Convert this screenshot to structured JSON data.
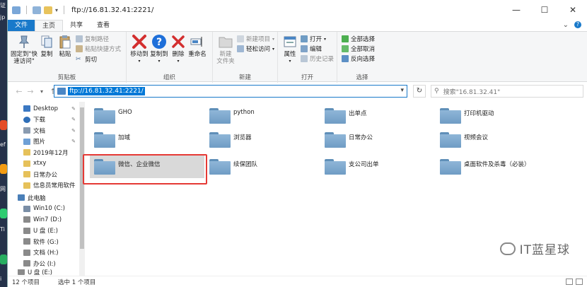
{
  "desktop_edge": [
    "证",
    "jp",
    "ef",
    "网",
    "Ti",
    "i"
  ],
  "window": {
    "title": "ftp://16.81.32.41:2221/",
    "controls": {
      "minimize": "—",
      "maximize": "☐",
      "close": "✕"
    }
  },
  "ribbon_tabs": [
    {
      "label": "文件"
    },
    {
      "label": "主页"
    },
    {
      "label": "共享"
    },
    {
      "label": "查看"
    }
  ],
  "ribbon": {
    "clipboard": {
      "label": "剪贴板",
      "pin": "固定到\"快\n速访问\"",
      "copy": "复制",
      "paste": "粘贴",
      "copy_path": "复制路径",
      "paste_shortcut": "粘贴快捷方式",
      "cut": "剪切"
    },
    "organize": {
      "label": "组织",
      "move_to": "移动到",
      "copy_to": "复制到",
      "delete": "删除",
      "rename": "重命名"
    },
    "new": {
      "label": "新建",
      "new_folder": "新建\n文件夹",
      "new_item": "新建项目",
      "easy_access": "轻松访问"
    },
    "open": {
      "label": "打开",
      "properties": "属性",
      "open": "打开",
      "edit": "编辑",
      "history": "历史记录"
    },
    "select": {
      "label": "选择",
      "select_all": "全部选择",
      "select_none": "全部取消",
      "invert": "反向选择"
    }
  },
  "address_bar": {
    "path": "ftp://16.81.32.41:2221/",
    "search_placeholder": "搜索\"16.81.32.41\""
  },
  "nav_pane": [
    {
      "label": "Desktop",
      "pinned": true,
      "color": "#3b78c2"
    },
    {
      "label": "下载",
      "pinned": true,
      "color": "#2f6fb8"
    },
    {
      "label": "文档",
      "pinned": true,
      "color": "#8a9bb0"
    },
    {
      "label": "图片",
      "pinned": true,
      "color": "#6fa0d6"
    },
    {
      "label": "2019年12月",
      "pinned": false,
      "color": "#e6c15a"
    },
    {
      "label": "xtxy",
      "pinned": false,
      "color": "#e6c15a"
    },
    {
      "label": "日常办公",
      "pinned": false,
      "color": "#e6c15a"
    },
    {
      "label": "信息员常用软件",
      "pinned": false,
      "color": "#e6c15a"
    },
    {
      "label": "此电脑",
      "pinned": false,
      "color": "#4a7fb8"
    },
    {
      "label": "Win10 (C:)",
      "pinned": false,
      "color": "#7a8ea6"
    },
    {
      "label": "Win7 (D:)",
      "pinned": false,
      "color": "#8a8a8a"
    },
    {
      "label": "U 盘 (E:)",
      "pinned": false,
      "color": "#8a8a8a"
    },
    {
      "label": "软件 (G:)",
      "pinned": false,
      "color": "#8a8a8a"
    },
    {
      "label": "文档 (H:)",
      "pinned": false,
      "color": "#8a8a8a"
    },
    {
      "label": "办公 (I:)",
      "pinned": false,
      "color": "#8a8a8a"
    },
    {
      "label": "U 盘 (E:)",
      "pinned": false,
      "color": "#8a8a8a"
    }
  ],
  "folders": [
    {
      "name": "GHO",
      "selected": false
    },
    {
      "name": "python",
      "selected": false
    },
    {
      "name": "出单点",
      "selected": false
    },
    {
      "name": "打印机驱动",
      "selected": false
    },
    {
      "name": "加域",
      "selected": false
    },
    {
      "name": "浏览器",
      "selected": false
    },
    {
      "name": "日常办公",
      "selected": false
    },
    {
      "name": "视频会议",
      "selected": false
    },
    {
      "name": "微信、企业微信",
      "selected": true
    },
    {
      "name": "续保团队",
      "selected": false
    },
    {
      "name": "支公司出单",
      "selected": false
    },
    {
      "name": "桌面软件及杀毒（必装）",
      "selected": false
    }
  ],
  "status": {
    "item_count": "12 个项目",
    "selected_count": "选中 1 个项目"
  },
  "watermark": "IT蓝星球",
  "colors": {
    "accent": "#1979ca",
    "selection_outline": "#e53935",
    "folder": "#7fa8cf"
  }
}
